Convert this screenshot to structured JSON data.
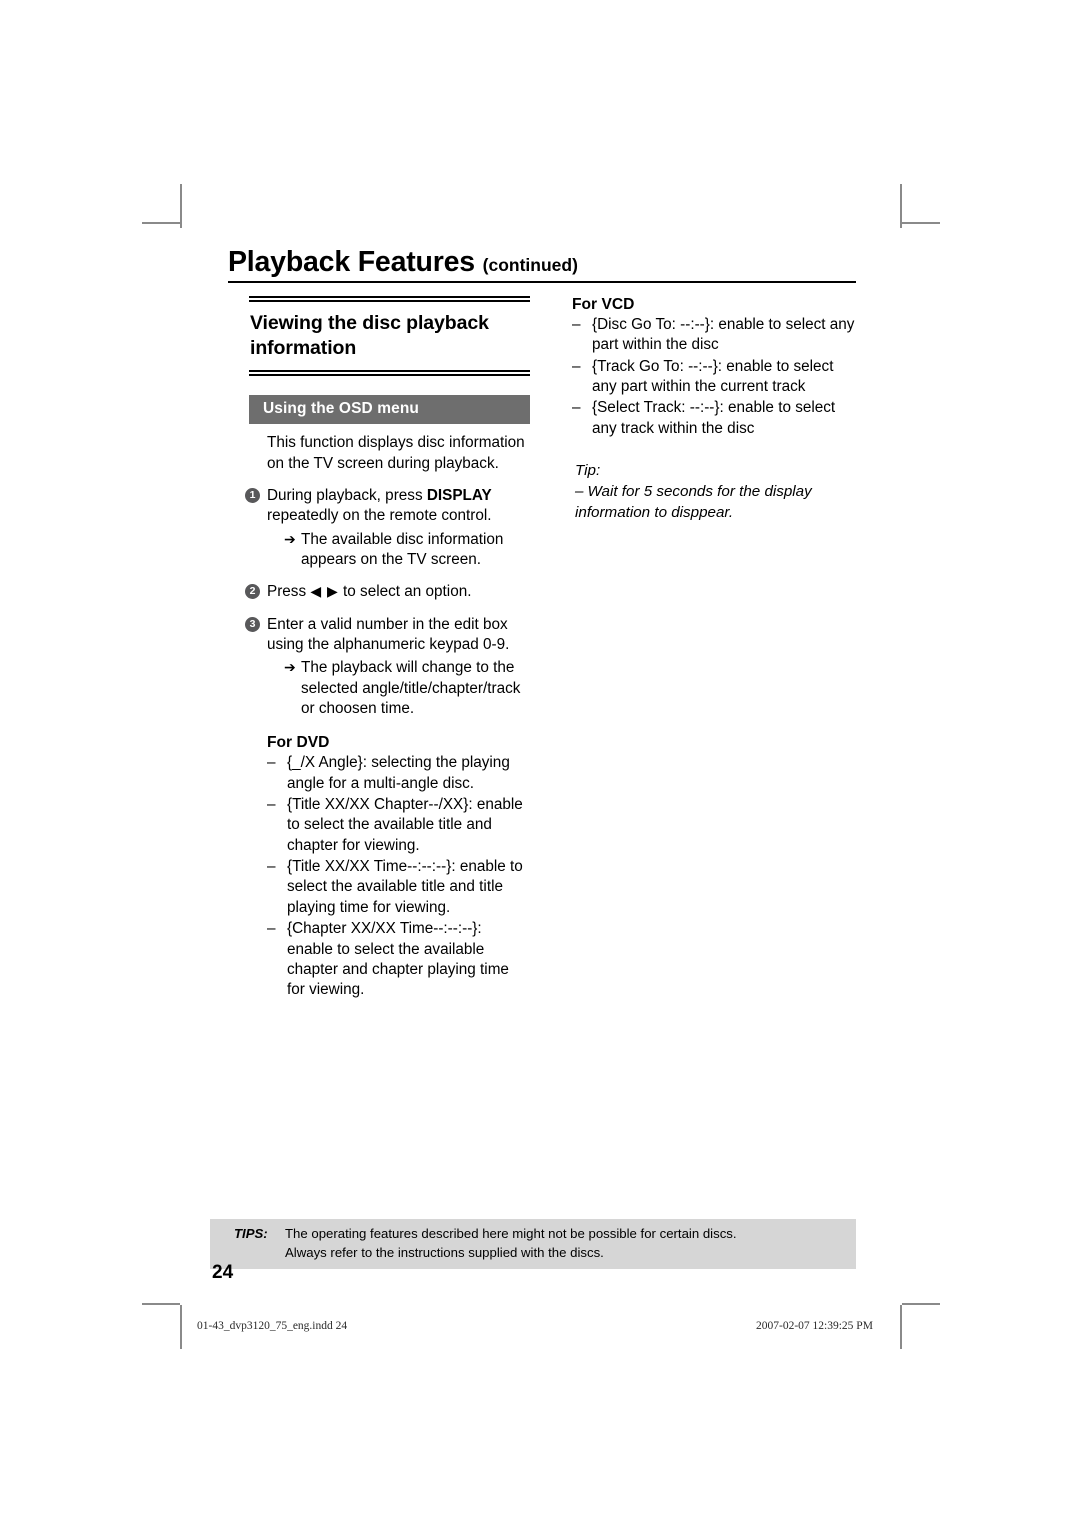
{
  "header": {
    "title": "Playback Features",
    "continued": "(continued)"
  },
  "left_column": {
    "section_heading": "Viewing the disc playback information",
    "osd_bar_label": "Using the OSD menu",
    "intro": "This function displays disc information on the TV screen during playback.",
    "steps": [
      {
        "num": "1",
        "text_before": "During playback, press ",
        "bold": "DISPLAY",
        "text_after": " repeatedly on the remote control.",
        "results": [
          "The available disc information appears on the TV screen."
        ]
      },
      {
        "num": "2",
        "text_before": "Press ",
        "bold": "",
        "nav_glyphs": "◀ ▶",
        "text_after": " to select an option.",
        "results": []
      },
      {
        "num": "3",
        "text_before": "Enter a valid number in the edit box using the alphanumeric keypad 0-9.",
        "bold": "",
        "text_after": "",
        "results": [
          "The playback will change to the selected angle/title/chapter/track or choosen time."
        ]
      }
    ],
    "dvd_heading": "For DVD",
    "dvd_items": [
      "{_/X Angle}: selecting the playing angle for a multi-angle disc.",
      "{Title XX/XX Chapter--/XX}: enable to select the available title and chapter for viewing.",
      "{Title XX/XX Time--:--:--}: enable to select the available title and title playing time for viewing.",
      "{Chapter XX/XX Time--:--:--}: enable to select the available chapter and chapter playing time for viewing."
    ]
  },
  "right_column": {
    "vcd_heading": "For VCD",
    "vcd_items": [
      "{Disc Go To: --:--}: enable to select any part within the disc",
      "{Track Go To: --:--}: enable to select any part within the current track",
      "{Select Track: --:--}: enable to select any track within the disc"
    ],
    "tip_label": "Tip:",
    "tip_text": "Wait for 5 seconds for the display information to disppear."
  },
  "footer": {
    "tips_label": "TIPS:",
    "tips_line1": "The operating features described here might not be possible for certain discs.",
    "tips_line2": "Always refer to the instructions supplied with the discs.",
    "page_number": "24",
    "slug_left": "01-43_dvp3120_75_eng.indd   24",
    "slug_right": "2007-02-07   12:39:25 PM"
  },
  "symbols": {
    "dash": "–",
    "arrow": "➔",
    "nav_left_right": "◀ ▶"
  },
  "colors": {
    "osd_bar_bg": "#6e6e6e",
    "step_marker_bg": "#58585a",
    "tips_band_bg": "#d6d6d6",
    "crop_mark": "#8a8a8a",
    "text": "#000000"
  }
}
